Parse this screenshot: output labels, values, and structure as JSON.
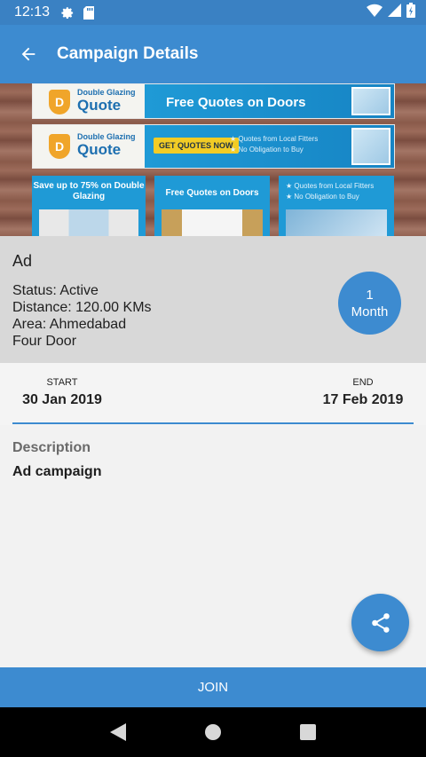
{
  "status_bar": {
    "time": "12:13",
    "icons": [
      "gear-icon",
      "sd-card-icon",
      "wifi-icon",
      "signal-icon",
      "battery-icon"
    ]
  },
  "app_bar": {
    "title": "Campaign Details",
    "back_icon": "arrow-left-icon"
  },
  "banner": {
    "strip1": {
      "brand_small": "Double Glazing",
      "brand_big": "Quote",
      "headline": "Free Quotes on Doors"
    },
    "strip2": {
      "brand_small": "Double Glazing",
      "brand_big": "Quote",
      "cta": "GET QUOTES NOW",
      "bullet1": "★ Quotes from Local Fitters",
      "bullet2": "★ No Obligation to Buy"
    },
    "tile1": "Save up to 75% on Double Glazing",
    "tile2": "Free Quotes on Doors",
    "tile3_bullet1": "★ Quotes from Local Fitters",
    "tile3_bullet2": "★ No Obligation to Buy"
  },
  "campaign": {
    "title": "Ad",
    "status": "Status: Active",
    "distance": "Distance: 120.00 KMs",
    "area": "Area: Ahmedabad",
    "name": "Four Door",
    "duration_value": "1",
    "duration_unit": "Month"
  },
  "dates": {
    "start_label": "START",
    "start_value": "30 Jan 2019",
    "end_label": "END",
    "end_value": "17 Feb 2019"
  },
  "description": {
    "label": "Description",
    "value": "Ad campaign"
  },
  "actions": {
    "share_icon": "share-icon",
    "join_label": "JOIN"
  },
  "colors": {
    "primary": "#3d8bd0",
    "status_bar": "#3a81c3",
    "panel_grey": "#d8d8d8"
  }
}
